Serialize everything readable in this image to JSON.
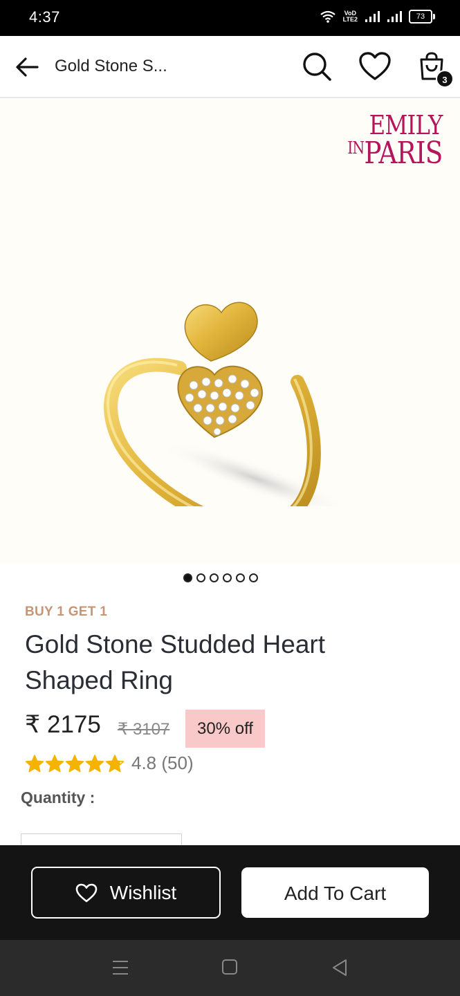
{
  "status_bar": {
    "time": "4:37",
    "network_label_top": "VoD",
    "network_label_bottom": "LTE2",
    "battery": "73"
  },
  "header": {
    "title": "Gold Stone S...",
    "cart_count": "3",
    "icons": [
      "back-arrow-icon",
      "search-icon",
      "heart-icon",
      "shopping-bag-icon"
    ]
  },
  "product_image": {
    "brand_line1": "EMILY",
    "brand_line2_prefix": "IN",
    "brand_line2_main": "PARIS",
    "image_count": 6,
    "active_index": 0
  },
  "product": {
    "offer_tag": "BUY 1 GET 1",
    "title": "Gold Stone Studded Heart Shaped Ring",
    "price": "₹ 2175",
    "mrp": "₹ 3107",
    "discount": "30% off",
    "rating_value": 4.8,
    "rating_text": "4.8 (50)",
    "quantity_label": "Quantity :"
  },
  "actions": {
    "wishlist_label": "Wishlist",
    "add_to_cart_label": "Add To Cart"
  },
  "colors": {
    "brand_pink": "#b4155b",
    "offer_tag": "#c89574",
    "discount_bg": "#f9c9c9",
    "star": "#f5b301",
    "bottom_bar": "#141414"
  }
}
